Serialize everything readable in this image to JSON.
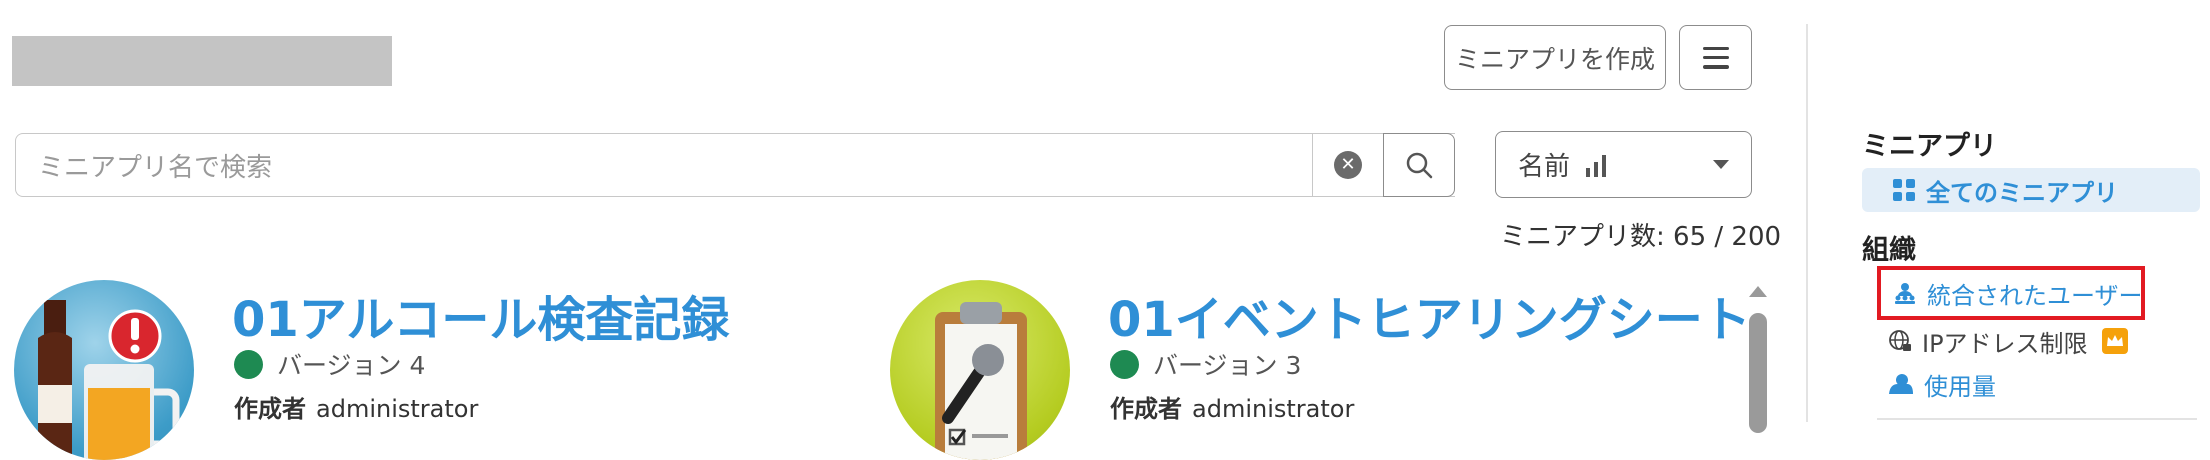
{
  "header": {
    "create_button": "ミニアプリを作成",
    "menu_icon": "hamburger-menu-icon"
  },
  "search": {
    "placeholder": "ミニアプリ名で検索",
    "clear_icon": "clear-icon",
    "search_icon": "search-icon"
  },
  "sort": {
    "selected": "名前",
    "sort_icon": "sort-bars-icon"
  },
  "count": {
    "text": "ミニアプリ数: 65 / 200"
  },
  "apps": [
    {
      "title": "01アルコール検査記録",
      "version": "バージョン 4",
      "creator_label": "作成者",
      "creator": "administrator",
      "icon": "beer-bottle-alert-icon",
      "status_color": "#1e8a52"
    },
    {
      "title": "01イベントヒアリングシート",
      "version": "バージョン 3",
      "creator_label": "作成者",
      "creator": "administrator",
      "icon": "clipboard-microphone-icon",
      "status_color": "#1e8a52"
    }
  ],
  "sidebar": {
    "miniapp_heading": "ミニアプリ",
    "all_apps": "全てのミニアプリ",
    "org_heading": "組織",
    "users": "統合されたユーザー",
    "ip_restriction": "IPアドレス制限",
    "usage": "使用量"
  },
  "colors": {
    "accent": "#2f8fd6",
    "highlight_border": "#e21a22",
    "status_active": "#1e8a52",
    "premium": "#f5a10b"
  }
}
